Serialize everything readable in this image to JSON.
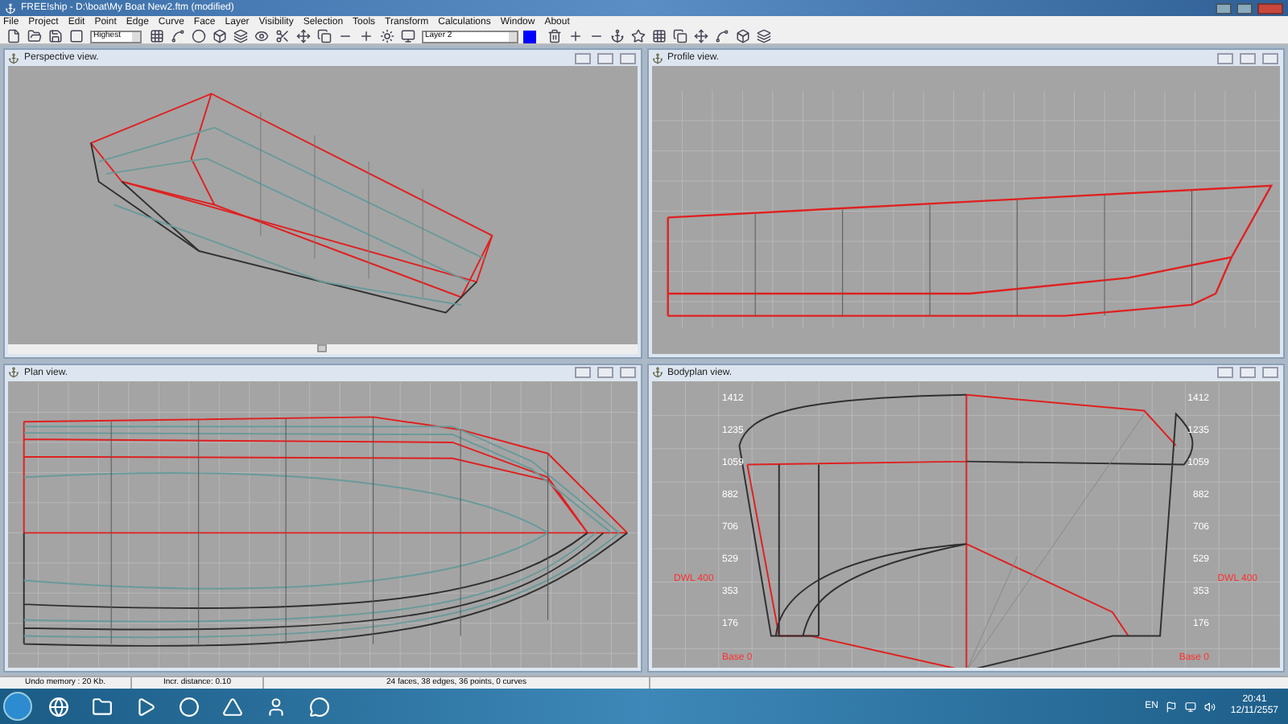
{
  "window": {
    "title": "FREE!ship - D:\\boat\\My Boat New2.ftm (modified)"
  },
  "menu": [
    "File",
    "Project",
    "Edit",
    "Point",
    "Edge",
    "Curve",
    "Face",
    "Layer",
    "Visibility",
    "Selection",
    "Tools",
    "Transform",
    "Calculations",
    "Window",
    "About"
  ],
  "toolbar": {
    "precision": "Highest",
    "layer": "Layer 2"
  },
  "views": [
    {
      "kind": "perspective",
      "title": "Perspective view."
    },
    {
      "kind": "profile",
      "title": "Profile view."
    },
    {
      "kind": "plan",
      "title": "Plan view."
    },
    {
      "kind": "bodyplan",
      "title": "Bodyplan view.",
      "left_labels": [
        "1412",
        "1235",
        "1059",
        "882",
        "706",
        "529",
        "353",
        "176"
      ],
      "right_labels": [
        "1412",
        "1235",
        "1059",
        "882",
        "706",
        "529",
        "353",
        "176"
      ],
      "waterline_labels": [
        "DWL 400",
        "DWL 400"
      ],
      "base_labels": [
        "Base 0",
        "Base 0"
      ]
    }
  ],
  "status_bar": [
    "Undo memory : 20 Kb.",
    "Incr. distance: 0.10",
    "24 faces, 38 edges, 36 points, 0 curves"
  ],
  "taskbar": {
    "language": "EN",
    "time": "20:41",
    "date": "12/11/2557"
  }
}
